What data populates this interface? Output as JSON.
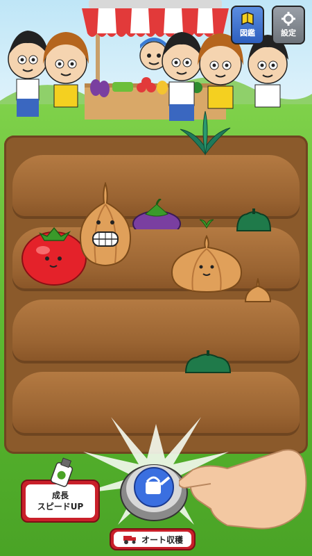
{
  "toolbar": {
    "zukan_label": "図鑑",
    "settings_label": "設定"
  },
  "controls": {
    "speed_line1": "成長",
    "speed_line2": "スピードUP",
    "auto_harvest_label": "オート収穫"
  },
  "colors": {
    "soil": "#9a6432",
    "button_red": "#c9202a",
    "grass": "#6cc13a"
  },
  "icons": {
    "zukan": "book-icon",
    "settings": "gear-icon",
    "speed": "fertilizer-bottle-icon",
    "auto": "tractor-icon",
    "water": "watering-can-icon"
  }
}
